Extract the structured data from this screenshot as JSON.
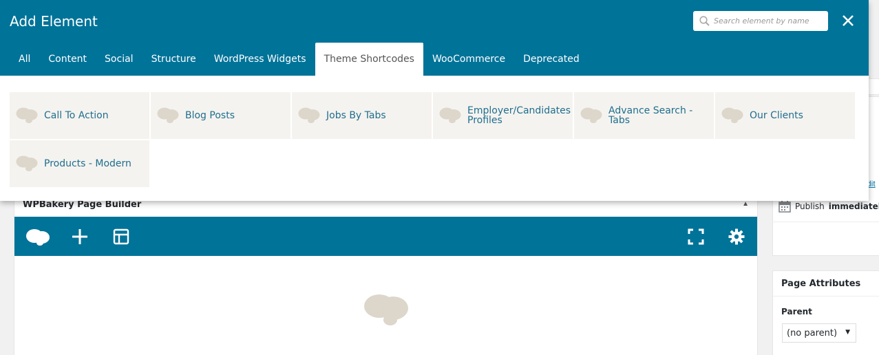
{
  "modal": {
    "title": "Add Element",
    "search_placeholder": "Search element by name",
    "tabs": [
      {
        "label": "All"
      },
      {
        "label": "Content"
      },
      {
        "label": "Social"
      },
      {
        "label": "Structure"
      },
      {
        "label": "WordPress Widgets"
      },
      {
        "label": "Theme Shortcodes",
        "active": true
      },
      {
        "label": "WooCommerce"
      },
      {
        "label": "Deprecated"
      }
    ],
    "elements": [
      {
        "label": "Call To Action"
      },
      {
        "label": "Blog Posts"
      },
      {
        "label": "Jobs By Tabs"
      },
      {
        "label": "Employer/Candidates Profiles"
      },
      {
        "label": "Advance Search - Tabs"
      },
      {
        "label": "Our Clients"
      },
      {
        "label": "Products - Modern"
      }
    ]
  },
  "page_builder": {
    "title": "WPBakery Page Builder",
    "toolbar_icons": [
      "wpbakery-logo-icon",
      "add-icon",
      "layout-icon",
      "fullscreen-icon",
      "gear-icon"
    ]
  },
  "sidebar": {
    "edit_link": "dit",
    "publish_label": "Publish",
    "publish_value": "immediately",
    "page_attributes_title": "Page Attributes",
    "parent_label": "Parent",
    "parent_value": "(no parent)"
  },
  "colors": {
    "brand_teal": "#007399",
    "element_bg": "#f5f3ef",
    "element_text": "#1e6e8f",
    "cloud_icon": "#ddd6ca"
  }
}
